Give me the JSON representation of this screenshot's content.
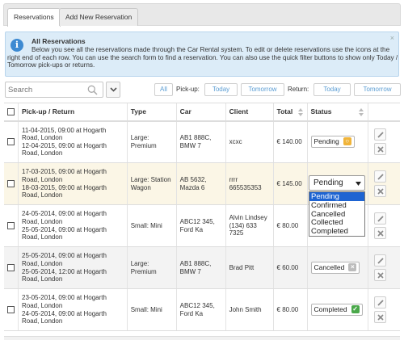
{
  "tabs": [
    {
      "label": "Reservations",
      "active": true
    },
    {
      "label": "Add New Reservation",
      "active": false
    }
  ],
  "info": {
    "title": "All Reservations",
    "text": "Below you see all the reservations made through the Car Rental system. To edit or delete reservations use the icons at the right end of each row. You can use the search form to find a reservation. You can also use the quick filter buttons to show only Today / Tomorrow pick-ups or returns.",
    "close": "×"
  },
  "search": {
    "placeholder": "Search"
  },
  "filters": {
    "all": "All",
    "pickup_label": "Pick-up:",
    "pickup_today": "Today",
    "pickup_tomorrow": "Tomorrow",
    "return_label": "Return:",
    "return_today": "Today",
    "return_tomorrow": "Tomorrow"
  },
  "table": {
    "headers": {
      "pickup": "Pick-up / Return",
      "type": "Type",
      "car": "Car",
      "client": "Client",
      "total": "Total",
      "status": "Status"
    },
    "rows": [
      {
        "pickup": "11-04-2015, 09:00 at Hogarth Road, London",
        "ret": "12-04-2015, 09:00 at Hogarth Road, London",
        "type": "Large: Premium",
        "car": "AB1 888C, BMW 7",
        "client": "xcxc",
        "total": "€ 140.00",
        "status": "Pending",
        "status_icon": "pending-icon"
      },
      {
        "pickup": "17-03-2015, 09:00 at Hogarth Road, London",
        "ret": "18-03-2015, 09:00 at Hogarth Road, London",
        "type": "Large: Station Wagon",
        "car": "AB 5632, Mazda 6",
        "client": "rrrr 665535353",
        "total": "€ 145.00",
        "status": "Pending",
        "status_icon": "select-caret-icon"
      },
      {
        "pickup": "24-05-2014, 09:00 at Hogarth Road, London",
        "ret": "25-05-2014, 09:00 at Hogarth Road, London",
        "type": "Small: Mini",
        "car": "ABC12 345, Ford Ka",
        "client": "Alvin Lindsey (134) 633 7325",
        "total": "€ 80.00",
        "status": "",
        "status_icon": ""
      },
      {
        "pickup": "25-05-2014, 09:00 at Hogarth Road, London",
        "ret": "25-05-2014, 12:00 at Hogarth Road, London",
        "type": "Large: Premium",
        "car": "AB1 888C, BMW 7",
        "client": "Brad Pitt",
        "total": "€ 60.00",
        "status": "Cancelled",
        "status_icon": "cancel-icon"
      },
      {
        "pickup": "23-05-2014, 09:00 at Hogarth Road, London",
        "ret": "24-05-2014, 09:00 at Hogarth Road, London",
        "type": "Small: Mini",
        "car": "ABC12 345, Ford Ka",
        "client": "John Smith",
        "total": "€ 80.00",
        "status": "Completed",
        "status_icon": "check-icon"
      }
    ]
  },
  "status_dropdown": {
    "selected": "Pending",
    "options": [
      "Pending",
      "Confirmed",
      "Cancelled",
      "Collected",
      "Completed"
    ]
  },
  "colors": {
    "link": "#5fa2d8",
    "info_bg": "#dcecf8",
    "pending": "#f0b43a",
    "completed": "#4aa84a",
    "highlight_row": "#fbf6e6",
    "selected_option": "#1e64d2"
  }
}
